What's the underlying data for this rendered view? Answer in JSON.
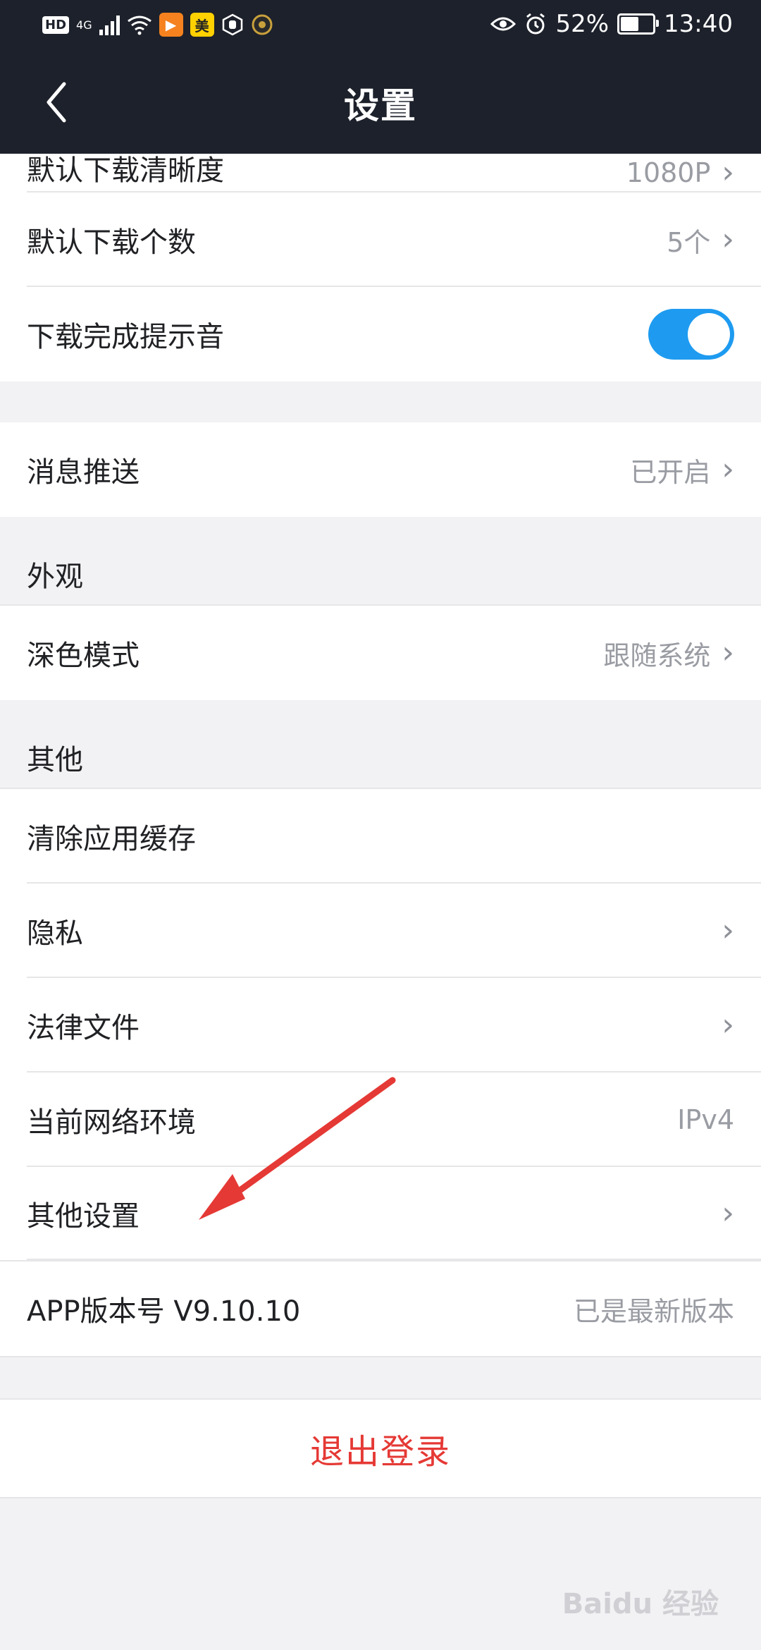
{
  "status_bar": {
    "hd": "HD",
    "net": "4G",
    "battery": "52%",
    "time": "13:40",
    "app_badge_1": "▶",
    "app_badge_2": "美"
  },
  "header": {
    "title": "设置",
    "back_icon": "chevron-left-icon"
  },
  "partial_row": {
    "label": "默认下载清晰度",
    "value": "1080P"
  },
  "download": [
    {
      "label": "默认下载个数",
      "value": "5个"
    },
    {
      "label": "下载完成提示音",
      "toggle_on": true
    }
  ],
  "push": {
    "label": "消息推送",
    "value": "已开启"
  },
  "appearance": {
    "section": "外观",
    "dark_mode": {
      "label": "深色模式",
      "value": "跟随系统"
    }
  },
  "other": {
    "section": "其他",
    "items": [
      {
        "label": "清除应用缓存"
      },
      {
        "label": "隐私"
      },
      {
        "label": "法律文件"
      },
      {
        "label": "当前网络环境",
        "value": "IPv4"
      },
      {
        "label": "其他设置"
      },
      {
        "label": "APP版本号 V9.10.10",
        "value": "已是最新版本"
      }
    ]
  },
  "logout": "退出登录",
  "colors": {
    "header_bg": "#1d212b",
    "toggle_on": "#1e9bf0",
    "logout_text": "#e53935",
    "annotation_arrow": "#e53935"
  },
  "watermark": "Baidu 经验",
  "chevron": "›"
}
